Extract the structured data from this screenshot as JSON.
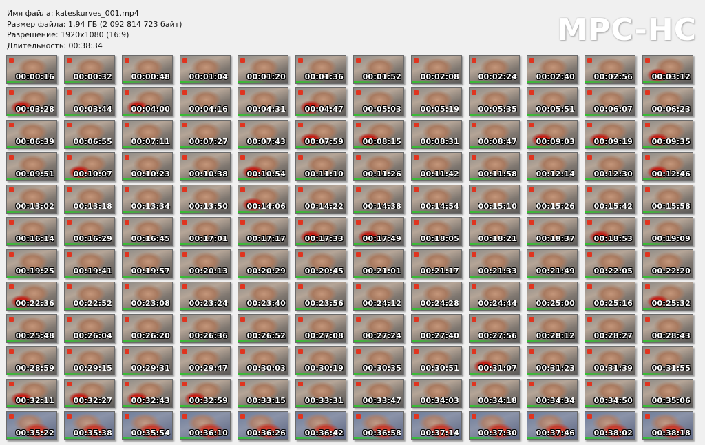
{
  "header": {
    "filename": "Имя файла: kateskurves_001.mp4",
    "filesize": "Размер файла: 1,94 ГБ (2 092 814 723 байт)",
    "resolution": "Разрешение: 1920x1080 (16:9)",
    "duration": "Длительность: 00:38:34"
  },
  "logo": "MPC-HC",
  "thumbnails": [
    "00:00:16",
    "00:00:32",
    "00:00:48",
    "00:01:04",
    "00:01:20",
    "00:01:36",
    "00:01:52",
    "00:02:08",
    "00:02:24",
    "00:02:40",
    "00:02:56",
    "00:03:12",
    "00:03:28",
    "00:03:44",
    "00:04:00",
    "00:04:16",
    "00:04:31",
    "00:04:47",
    "00:05:03",
    "00:05:19",
    "00:05:35",
    "00:05:51",
    "00:06:07",
    "00:06:23",
    "00:06:39",
    "00:06:55",
    "00:07:11",
    "00:07:27",
    "00:07:43",
    "00:07:59",
    "00:08:15",
    "00:08:31",
    "00:08:47",
    "00:09:03",
    "00:09:19",
    "00:09:35",
    "00:09:51",
    "00:10:07",
    "00:10:23",
    "00:10:38",
    "00:10:54",
    "00:11:10",
    "00:11:26",
    "00:11:42",
    "00:11:58",
    "00:12:14",
    "00:12:30",
    "00:12:46",
    "00:13:02",
    "00:13:18",
    "00:13:34",
    "00:13:50",
    "00:14:06",
    "00:14:22",
    "00:14:38",
    "00:14:54",
    "00:15:10",
    "00:15:26",
    "00:15:42",
    "00:15:58",
    "00:16:14",
    "00:16:29",
    "00:16:45",
    "00:17:01",
    "00:17:17",
    "00:17:33",
    "00:17:49",
    "00:18:05",
    "00:18:21",
    "00:18:37",
    "00:18:53",
    "00:19:09",
    "00:19:25",
    "00:19:41",
    "00:19:57",
    "00:20:13",
    "00:20:29",
    "00:20:45",
    "00:21:01",
    "00:21:17",
    "00:21:33",
    "00:21:49",
    "00:22:05",
    "00:22:20",
    "00:22:36",
    "00:22:52",
    "00:23:08",
    "00:23:24",
    "00:23:40",
    "00:23:56",
    "00:24:12",
    "00:24:28",
    "00:24:44",
    "00:25:00",
    "00:25:16",
    "00:25:32",
    "00:25:48",
    "00:26:04",
    "00:26:20",
    "00:26:36",
    "00:26:52",
    "00:27:08",
    "00:27:24",
    "00:27:40",
    "00:27:56",
    "00:28:12",
    "00:28:27",
    "00:28:43",
    "00:28:59",
    "00:29:15",
    "00:29:31",
    "00:29:47",
    "00:30:03",
    "00:30:19",
    "00:30:35",
    "00:30:51",
    "00:31:07",
    "00:31:23",
    "00:31:39",
    "00:31:55",
    "00:32:11",
    "00:32:27",
    "00:32:43",
    "00:32:59",
    "00:33:15",
    "00:33:31",
    "00:33:47",
    "00:34:03",
    "00:34:18",
    "00:34:34",
    "00:34:50",
    "00:35:06",
    "00:35:22",
    "00:35:38",
    "00:35:54",
    "00:36:10",
    "00:36:26",
    "00:36:42",
    "00:36:58",
    "00:37:14",
    "00:37:30",
    "00:37:46",
    "00:38:02",
    "00:38:18"
  ]
}
